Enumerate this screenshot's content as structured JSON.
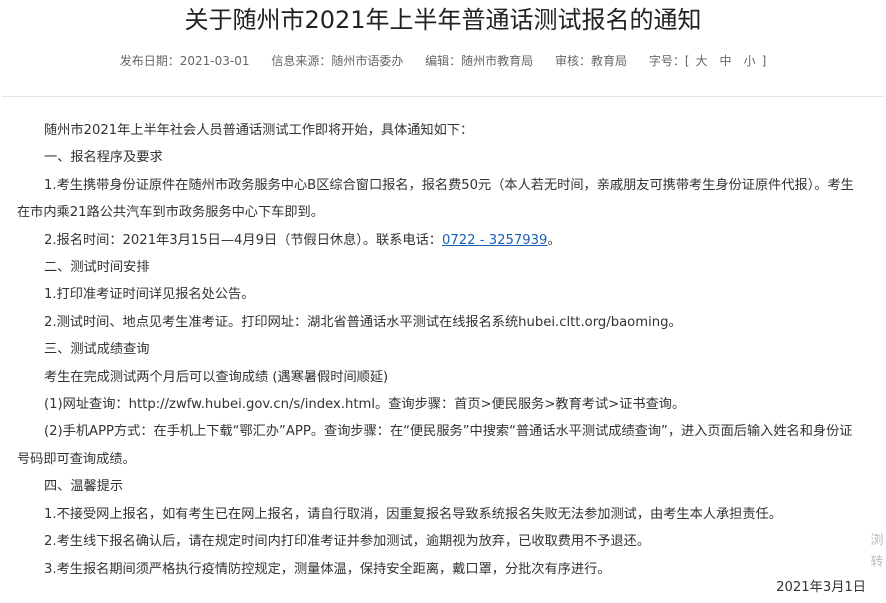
{
  "article": {
    "title": "关于随州市2021年上半年普通话测试报名的通知",
    "meta": {
      "publish_date": "发布日期：2021-03-01",
      "source": "信息来源：随州市语委办",
      "editor": "编辑：随州市教育局",
      "reviewer": "审核：教育局",
      "font_size_label": "字号：[",
      "font_size_large": "大",
      "font_size_medium": "中",
      "font_size_small": "小",
      "font_size_close": "]"
    },
    "paragraphs": [
      "随州市2021年上半年社会人员普通话测试工作即将开始，具体通知如下：",
      "一、报名程序及要求",
      "1.考生携带身份证原件在随州市政务服务中心B区综合窗口报名，报名费50元（本人若无时间，亲戚朋友可携带考生身份证原件代报）。考生在市内乘21路公共汽车到市政务服务中心下车即到。",
      "",
      "二、测试时间安排",
      "1.打印准考证时间详见报名处公告。",
      "2.测试时间、地点见考生准考证。打印网址：湖北省普通话水平测试在线报名系统hubei.cltt.org/baoming。",
      "三、测试成绩查询",
      "考生在完成测试两个月后可以查询成绩 (遇寒暑假时间顺延)",
      "(1)网址查询：http://zwfw.hubei.gov.cn/s/index.html。查询步骤：首页>便民服务>教育考试>证书查询。",
      "(2)手机APP方式：在手机上下载“鄂汇办”APP。查询步骤：在“便民服务”中搜索“普通话水平测试成绩查询”，进入页面后输入姓名和身份证号码即可查询成绩。",
      "四、温馨提示",
      "1.不接受网上报名，如有考生已在网上报名，请自行取消，因重复报名导致系统报名失败无法参加测试，由考生本人承担责任。",
      "2.考生线下报名确认后，请在规定时间内打印准考证并参加测试，逾期视为放弃，已收取费用不予退还。",
      "3.考生报名期间须严格执行疫情防控规定，测量体温，保持安全距离，戴口罩，分批次有序进行。"
    ],
    "registration_time": {
      "text": "2.报名时间：2021年3月15日—4月9日（节假日休息）。联系电话：",
      "phone": "0722 - 3257939",
      "suffix": "。"
    },
    "sign_date": "2021年3月1日"
  },
  "side_widget": {
    "line1": "浏",
    "line2": "转"
  }
}
